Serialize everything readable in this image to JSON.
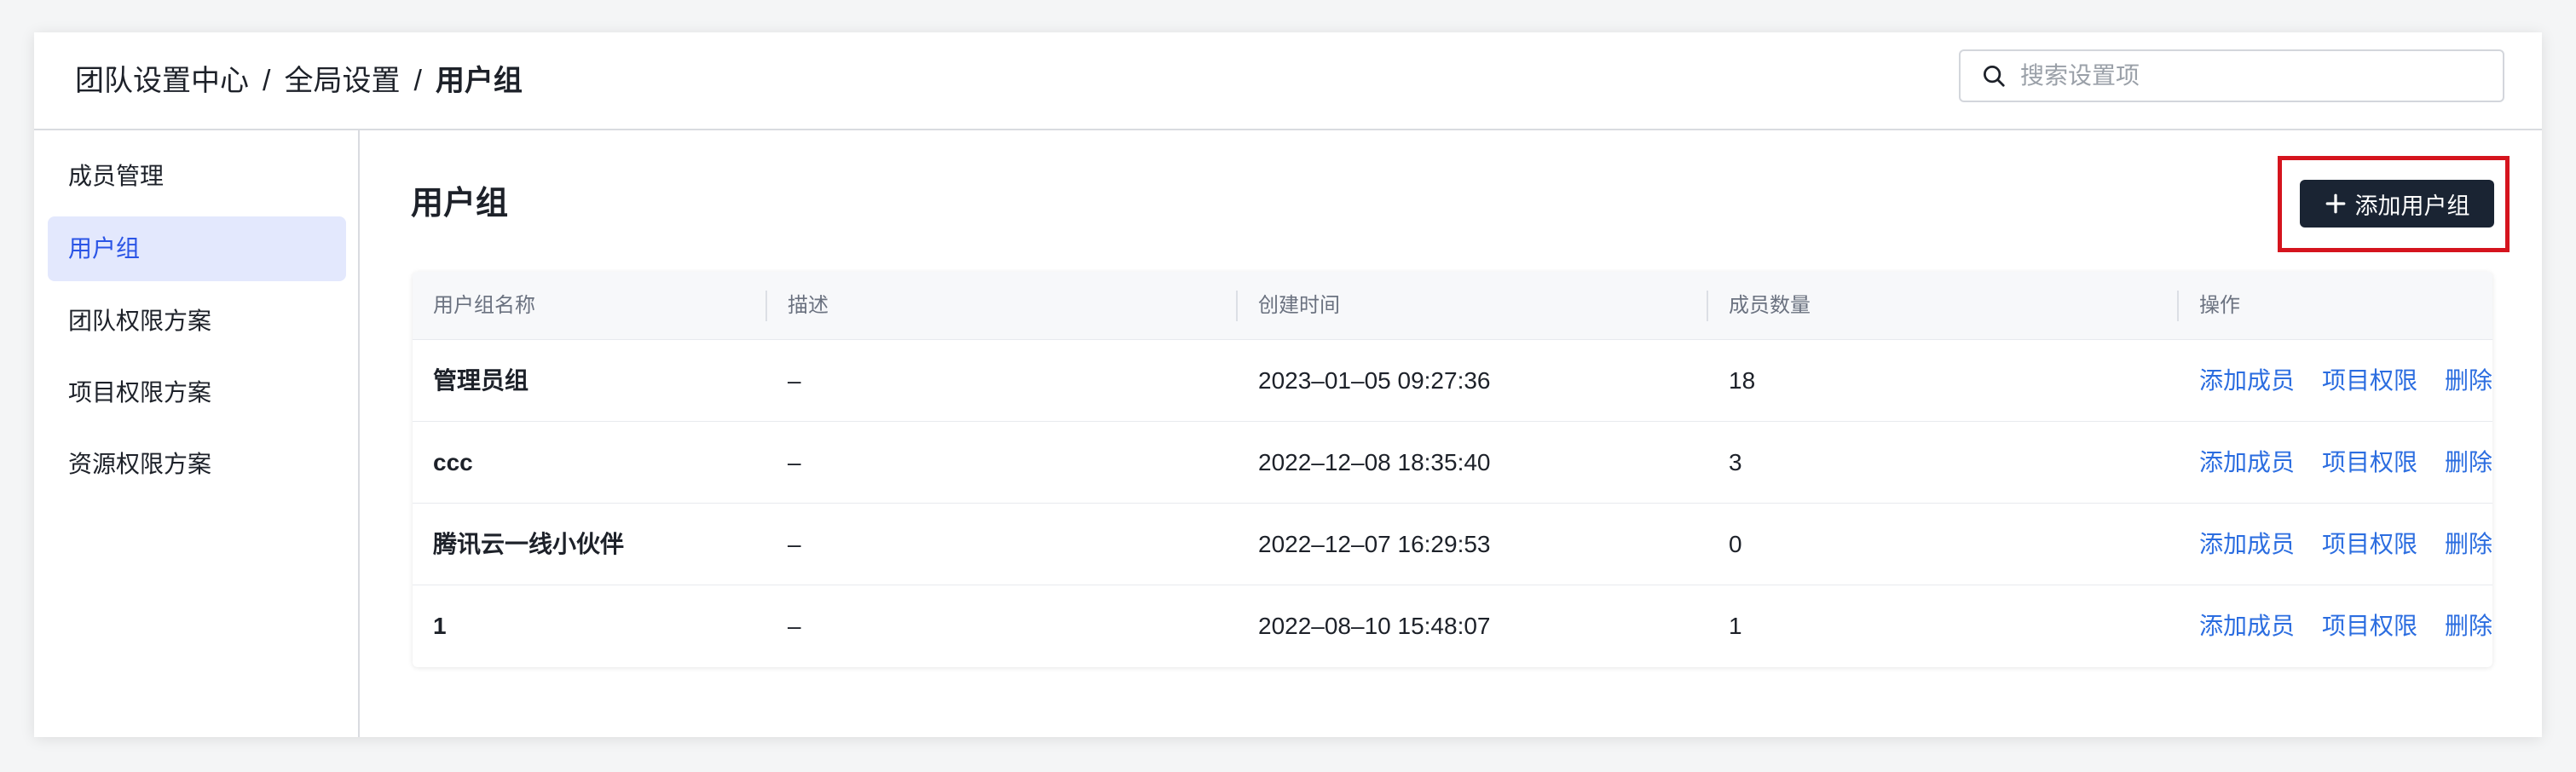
{
  "breadcrumb": {
    "items": [
      "团队设置中心",
      "全局设置"
    ],
    "separator": "/",
    "current": "用户组"
  },
  "search": {
    "placeholder": "搜索设置项",
    "icon": "search-icon"
  },
  "sidebar": {
    "items": [
      {
        "label": "成员管理",
        "active": false
      },
      {
        "label": "用户组",
        "active": true
      },
      {
        "label": "团队权限方案",
        "active": false
      },
      {
        "label": "项目权限方案",
        "active": false
      },
      {
        "label": "资源权限方案",
        "active": false
      }
    ]
  },
  "main": {
    "title": "用户组",
    "add_button": {
      "label": "添加用户组",
      "icon": "plus-icon"
    }
  },
  "table": {
    "columns": [
      "用户组名称",
      "描述",
      "创建时间",
      "成员数量",
      "操作"
    ],
    "rows": [
      {
        "name": "管理员组",
        "desc": "–",
        "created": "2023–01–05 09:27:36",
        "members": "18"
      },
      {
        "name": "ccc",
        "desc": "–",
        "created": "2022–12–08 18:35:40",
        "members": "3"
      },
      {
        "name": "腾讯云一线小伙伴",
        "desc": "–",
        "created": "2022–12–07 16:29:53",
        "members": "0"
      },
      {
        "name": "1",
        "desc": "–",
        "created": "2022–08–10 15:48:07",
        "members": "1"
      }
    ],
    "actions": {
      "add_member": "添加成员",
      "project_perm": "项目权限",
      "delete": "删除"
    }
  },
  "colors": {
    "accent": "#2b55e6",
    "link": "#2b6de0",
    "active_bg": "#e3e8fd",
    "button_bg": "#1a2433",
    "highlight_border": "#d5141e"
  }
}
